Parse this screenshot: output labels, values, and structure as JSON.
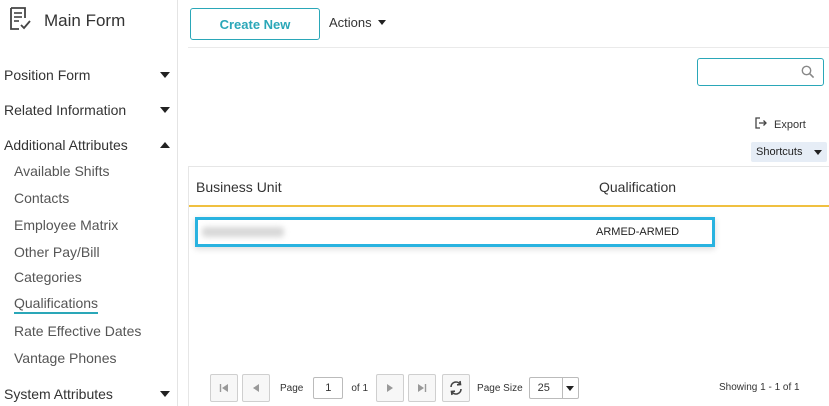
{
  "sidebar": {
    "title": "Main Form",
    "sections": [
      {
        "label": "Position Form",
        "expanded": false
      },
      {
        "label": "Related Information",
        "expanded": false
      },
      {
        "label": "Additional Attributes",
        "expanded": true
      },
      {
        "label": "System Attributes",
        "expanded": false
      }
    ],
    "sub_items": [
      {
        "label": "Available Shifts"
      },
      {
        "label": "Contacts"
      },
      {
        "label": "Employee Matrix"
      },
      {
        "label": "Other Pay/Bill"
      },
      {
        "label": "Categories"
      },
      {
        "label": "Qualifications",
        "active": true
      },
      {
        "label": "Rate Effective Dates"
      },
      {
        "label": "Vantage Phones"
      }
    ]
  },
  "toolbar": {
    "create_label": "Create New",
    "actions_label": "Actions",
    "export_label": "Export",
    "shortcuts_label": "Shortcuts",
    "search_placeholder": ""
  },
  "grid": {
    "columns": [
      "Business Unit",
      "Qualification"
    ],
    "rows": [
      {
        "business_unit": "",
        "qualification": "ARMED-ARMED"
      }
    ]
  },
  "pager": {
    "page_label": "Page",
    "page_value": "1",
    "of_label": "of 1",
    "page_size_label": "Page Size",
    "page_size_value": "25",
    "showing": "Showing 1 - 1 of 1"
  },
  "colors": {
    "accent": "#2aa7b8",
    "selection": "#29b3e0",
    "header_underline": "#f0c040"
  }
}
